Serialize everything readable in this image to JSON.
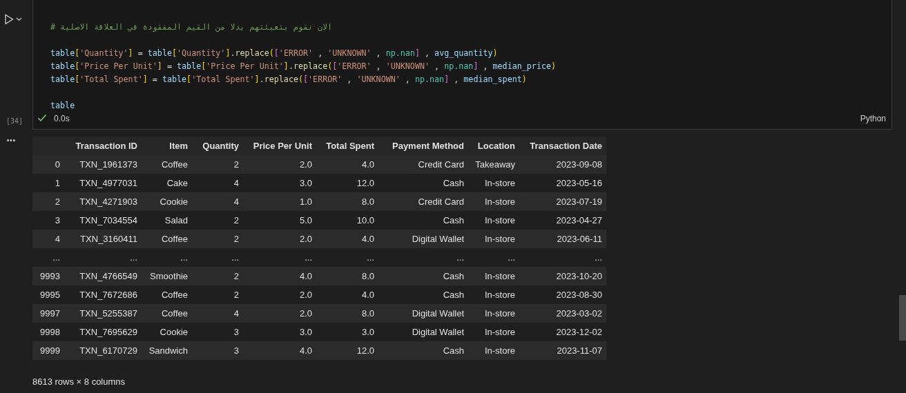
{
  "cell": {
    "execution_count": "[34]",
    "succeeded": true,
    "duration": "0.0s",
    "language": "Python",
    "blocks": [
      [
        [
          {
            "kind": "comment",
            "text": "# الان نقوم بتعبئتهم بدلا من القيم المفقودة في العلاقة الاصلية"
          }
        ]
      ],
      [
        [
          {
            "kind": "var",
            "text": "table"
          },
          {
            "kind": "b1",
            "text": "["
          },
          {
            "kind": "str",
            "text": "'Quantity'"
          },
          {
            "kind": "b1",
            "text": "]"
          },
          {
            "kind": "punct",
            "text": " = "
          },
          {
            "kind": "var",
            "text": "table"
          },
          {
            "kind": "b1",
            "text": "["
          },
          {
            "kind": "str",
            "text": "'Quantity'"
          },
          {
            "kind": "b1",
            "text": "]"
          },
          {
            "kind": "punct",
            "text": "."
          },
          {
            "kind": "func",
            "text": "replace"
          },
          {
            "kind": "b1",
            "text": "("
          },
          {
            "kind": "b2",
            "text": "["
          },
          {
            "kind": "str",
            "text": "'ERROR'"
          },
          {
            "kind": "punct",
            "text": " , "
          },
          {
            "kind": "str",
            "text": "'UNKNOWN'"
          },
          {
            "kind": "punct",
            "text": " , "
          },
          {
            "kind": "module",
            "text": "np.nan"
          },
          {
            "kind": "b2",
            "text": "]"
          },
          {
            "kind": "punct",
            "text": " , "
          },
          {
            "kind": "var",
            "text": "avg_quantity"
          },
          {
            "kind": "b1",
            "text": ")"
          }
        ],
        [
          {
            "kind": "var",
            "text": "table"
          },
          {
            "kind": "b1",
            "text": "["
          },
          {
            "kind": "str",
            "text": "'Price Per Unit'"
          },
          {
            "kind": "b1",
            "text": "]"
          },
          {
            "kind": "punct",
            "text": " = "
          },
          {
            "kind": "var",
            "text": "table"
          },
          {
            "kind": "b1",
            "text": "["
          },
          {
            "kind": "str",
            "text": "'Price Per Unit'"
          },
          {
            "kind": "b1",
            "text": "]"
          },
          {
            "kind": "punct",
            "text": "."
          },
          {
            "kind": "func",
            "text": "replace"
          },
          {
            "kind": "b1",
            "text": "("
          },
          {
            "kind": "b2",
            "text": "["
          },
          {
            "kind": "str",
            "text": "'ERROR'"
          },
          {
            "kind": "punct",
            "text": " , "
          },
          {
            "kind": "str",
            "text": "'UNKNOWN'"
          },
          {
            "kind": "punct",
            "text": " , "
          },
          {
            "kind": "module",
            "text": "np.nan"
          },
          {
            "kind": "b2",
            "text": "]"
          },
          {
            "kind": "punct",
            "text": " , "
          },
          {
            "kind": "var",
            "text": "median_price"
          },
          {
            "kind": "b1",
            "text": ")"
          }
        ],
        [
          {
            "kind": "var",
            "text": "table"
          },
          {
            "kind": "b1",
            "text": "["
          },
          {
            "kind": "str",
            "text": "'Total Spent'"
          },
          {
            "kind": "b1",
            "text": "]"
          },
          {
            "kind": "punct",
            "text": " = "
          },
          {
            "kind": "var",
            "text": "table"
          },
          {
            "kind": "b1",
            "text": "["
          },
          {
            "kind": "str",
            "text": "'Total Spent'"
          },
          {
            "kind": "b1",
            "text": "]"
          },
          {
            "kind": "punct",
            "text": "."
          },
          {
            "kind": "func",
            "text": "replace"
          },
          {
            "kind": "b1",
            "text": "("
          },
          {
            "kind": "b2",
            "text": "["
          },
          {
            "kind": "str",
            "text": "'ERROR'"
          },
          {
            "kind": "punct",
            "text": " , "
          },
          {
            "kind": "str",
            "text": "'UNKNOWN'"
          },
          {
            "kind": "punct",
            "text": " , "
          },
          {
            "kind": "module",
            "text": "np.nan"
          },
          {
            "kind": "b2",
            "text": "]"
          },
          {
            "kind": "punct",
            "text": " , "
          },
          {
            "kind": "var",
            "text": "median_spent"
          },
          {
            "kind": "b1",
            "text": ")"
          }
        ]
      ],
      [
        [
          {
            "kind": "var",
            "text": "table"
          }
        ]
      ]
    ]
  },
  "output": {
    "menu": "...",
    "table": {
      "columns": [
        "",
        "Transaction ID",
        "Item",
        "Quantity",
        "Price Per Unit",
        "Total Spent",
        "Payment Method",
        "Location",
        "Transaction Date"
      ],
      "rows": [
        [
          "0",
          "TXN_1961373",
          "Coffee",
          "2",
          "2.0",
          "4.0",
          "Credit Card",
          "Takeaway",
          "2023-09-08"
        ],
        [
          "1",
          "TXN_4977031",
          "Cake",
          "4",
          "3.0",
          "12.0",
          "Cash",
          "In-store",
          "2023-05-16"
        ],
        [
          "2",
          "TXN_4271903",
          "Cookie",
          "4",
          "1.0",
          "8.0",
          "Credit Card",
          "In-store",
          "2023-07-19"
        ],
        [
          "3",
          "TXN_7034554",
          "Salad",
          "2",
          "5.0",
          "10.0",
          "Cash",
          "In-store",
          "2023-04-27"
        ],
        [
          "4",
          "TXN_3160411",
          "Coffee",
          "2",
          "2.0",
          "4.0",
          "Digital Wallet",
          "In-store",
          "2023-06-11"
        ],
        [
          "...",
          "...",
          "...",
          "...",
          "...",
          "...",
          "...",
          "...",
          "..."
        ],
        [
          "9993",
          "TXN_4766549",
          "Smoothie",
          "2",
          "4.0",
          "8.0",
          "Cash",
          "In-store",
          "2023-10-20"
        ],
        [
          "9995",
          "TXN_7672686",
          "Coffee",
          "2",
          "2.0",
          "4.0",
          "Cash",
          "In-store",
          "2023-08-30"
        ],
        [
          "9997",
          "TXN_5255387",
          "Coffee",
          "4",
          "2.0",
          "8.0",
          "Digital Wallet",
          "In-store",
          "2023-03-02"
        ],
        [
          "9998",
          "TXN_7695629",
          "Cookie",
          "3",
          "3.0",
          "3.0",
          "Digital Wallet",
          "In-store",
          "2023-12-02"
        ],
        [
          "9999",
          "TXN_6170729",
          "Sandwich",
          "3",
          "4.0",
          "12.0",
          "Cash",
          "In-store",
          "2023-11-07"
        ]
      ]
    },
    "shape": "8613 rows × 8 columns"
  }
}
